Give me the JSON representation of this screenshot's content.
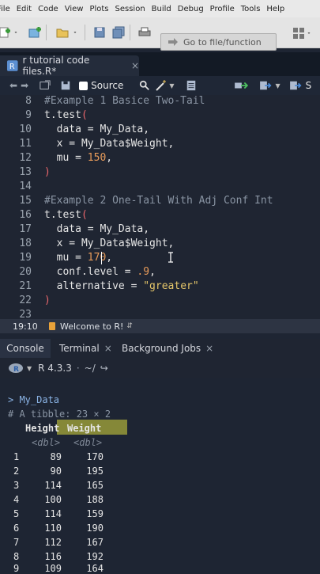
{
  "menubar": {
    "items": [
      "File",
      "Edit",
      "Code",
      "View",
      "Plots",
      "Session",
      "Build",
      "Debug",
      "Profile",
      "Tools",
      "Help"
    ]
  },
  "toolbar": {
    "goto_placeholder": "Go to file/function"
  },
  "editor_tab": {
    "title": "r tutorial code files.R*",
    "close": "×"
  },
  "editor_toolbar": {
    "source_label": "Source",
    "right_label": "S"
  },
  "code_lines": [
    {
      "n": "8",
      "t": "#Example 1 Basice Two-Tail"
    },
    {
      "n": "9",
      "t": "t.test("
    },
    {
      "n": "10",
      "t": "  data = My_Data,"
    },
    {
      "n": "11",
      "t": "  x = My_Data$Weight,"
    },
    {
      "n": "12",
      "t": "  mu = 150,"
    },
    {
      "n": "13",
      "t": ")"
    },
    {
      "n": "14",
      "t": ""
    },
    {
      "n": "15",
      "t": "#Example 2 One-Tail With Adj Conf Int"
    },
    {
      "n": "16",
      "t": "t.test("
    },
    {
      "n": "17",
      "t": "  data = My_Data,"
    },
    {
      "n": "18",
      "t": "  x = My_Data$Weight,"
    },
    {
      "n": "19",
      "t": "  mu = 170,"
    },
    {
      "n": "20",
      "t": "  conf.level = .9,"
    },
    {
      "n": "21",
      "t": "  alternative = \"greater\""
    },
    {
      "n": "22",
      "t": ")"
    },
    {
      "n": "23",
      "t": ""
    }
  ],
  "status": {
    "position": "19:10",
    "scope": "Welcome to R!"
  },
  "pane_tabs": [
    "Console",
    "Terminal",
    "Background Jobs"
  ],
  "console_header": {
    "version": "R 4.3.3",
    "path": "~/"
  },
  "console": {
    "prompt_line": "> My_Data",
    "tibble_line": "# A tibble: 23 × 2",
    "col_headers": [
      "Height",
      "Weight"
    ],
    "col_types": [
      "<dbl>",
      "<dbl>"
    ],
    "rows": [
      [
        "1",
        "89",
        "170"
      ],
      [
        "2",
        "90",
        "195"
      ],
      [
        "3",
        "114",
        "165"
      ],
      [
        "4",
        "100",
        "188"
      ],
      [
        "5",
        "114",
        "159"
      ],
      [
        "6",
        "110",
        "190"
      ],
      [
        "7",
        "112",
        "167"
      ],
      [
        "8",
        "116",
        "192"
      ],
      [
        "9",
        "109",
        "164"
      ]
    ]
  }
}
